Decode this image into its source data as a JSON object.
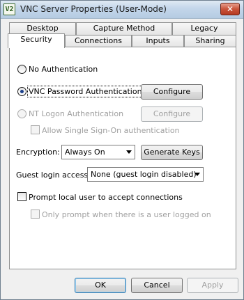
{
  "window": {
    "title": "VNC Server Properties (User-Mode)",
    "icon_text": "V2",
    "close_glyph": "✕"
  },
  "tabs": {
    "row1": [
      {
        "label": "Desktop"
      },
      {
        "label": "Capture Method"
      },
      {
        "label": "Legacy"
      }
    ],
    "row2": [
      {
        "label": "Security",
        "active": true
      },
      {
        "label": "Connections"
      },
      {
        "label": "Inputs"
      },
      {
        "label": "Sharing"
      }
    ]
  },
  "security": {
    "auth_options": [
      {
        "label": "No Authentication",
        "selected": false,
        "enabled": true
      },
      {
        "label": "VNC Password Authentication",
        "selected": true,
        "enabled": true,
        "button": "Configure"
      },
      {
        "label": "NT Logon Authentication",
        "selected": false,
        "enabled": false,
        "button": "Configure"
      }
    ],
    "sso_checkbox": {
      "label": "Allow Single Sign-On authentication",
      "checked": false,
      "enabled": false
    },
    "encryption": {
      "label": "Encryption:",
      "value": "Always On",
      "button": "Generate Keys"
    },
    "guest": {
      "label": "Guest login access:",
      "value": "None (guest login disabled)"
    },
    "prompt_checkbox": {
      "label": "Prompt local user to accept connections",
      "checked": false,
      "enabled": true
    },
    "only_prompt_checkbox": {
      "label": "Only prompt when there is a user logged on",
      "checked": false,
      "enabled": false
    }
  },
  "footer": {
    "ok": "OK",
    "cancel": "Cancel",
    "apply": "Apply"
  }
}
